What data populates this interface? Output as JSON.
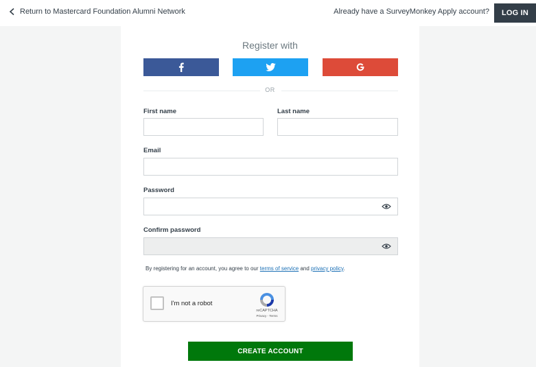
{
  "header": {
    "back_link": "Return to Mastercard Foundation Alumni Network",
    "already_text": "Already have a SurveyMonkey Apply account?",
    "login_label": "LOG IN"
  },
  "register": {
    "heading": "Register with",
    "social": [
      {
        "name": "facebook",
        "icon": "facebook-icon",
        "color": "#3b5998"
      },
      {
        "name": "twitter",
        "icon": "twitter-icon",
        "color": "#1da1f2"
      },
      {
        "name": "google",
        "icon": "google-icon",
        "color": "#dd4b39"
      }
    ],
    "or_text": "OR"
  },
  "form": {
    "first_name": {
      "label": "First name",
      "value": "",
      "placeholder": ""
    },
    "last_name": {
      "label": "Last name",
      "value": "",
      "placeholder": ""
    },
    "email": {
      "label": "Email",
      "value": "",
      "placeholder": ""
    },
    "password": {
      "label": "Password",
      "value": "",
      "placeholder": ""
    },
    "confirm_password": {
      "label": "Confirm password",
      "value": "",
      "placeholder": ""
    },
    "agreement": {
      "prefix": "By registering for an account, you agree to our ",
      "terms_link": "terms of service",
      "middle": " and ",
      "privacy_link": "privacy policy",
      "suffix": "."
    },
    "recaptcha": {
      "label": "I'm not a robot",
      "brand": "reCAPTCHA",
      "links": "Privacy - Terms"
    },
    "submit_label": "CREATE ACCOUNT"
  },
  "colors": {
    "primary_green": "#00780b",
    "dark_nav": "#333e48",
    "link_blue": "#1a6fb5"
  }
}
